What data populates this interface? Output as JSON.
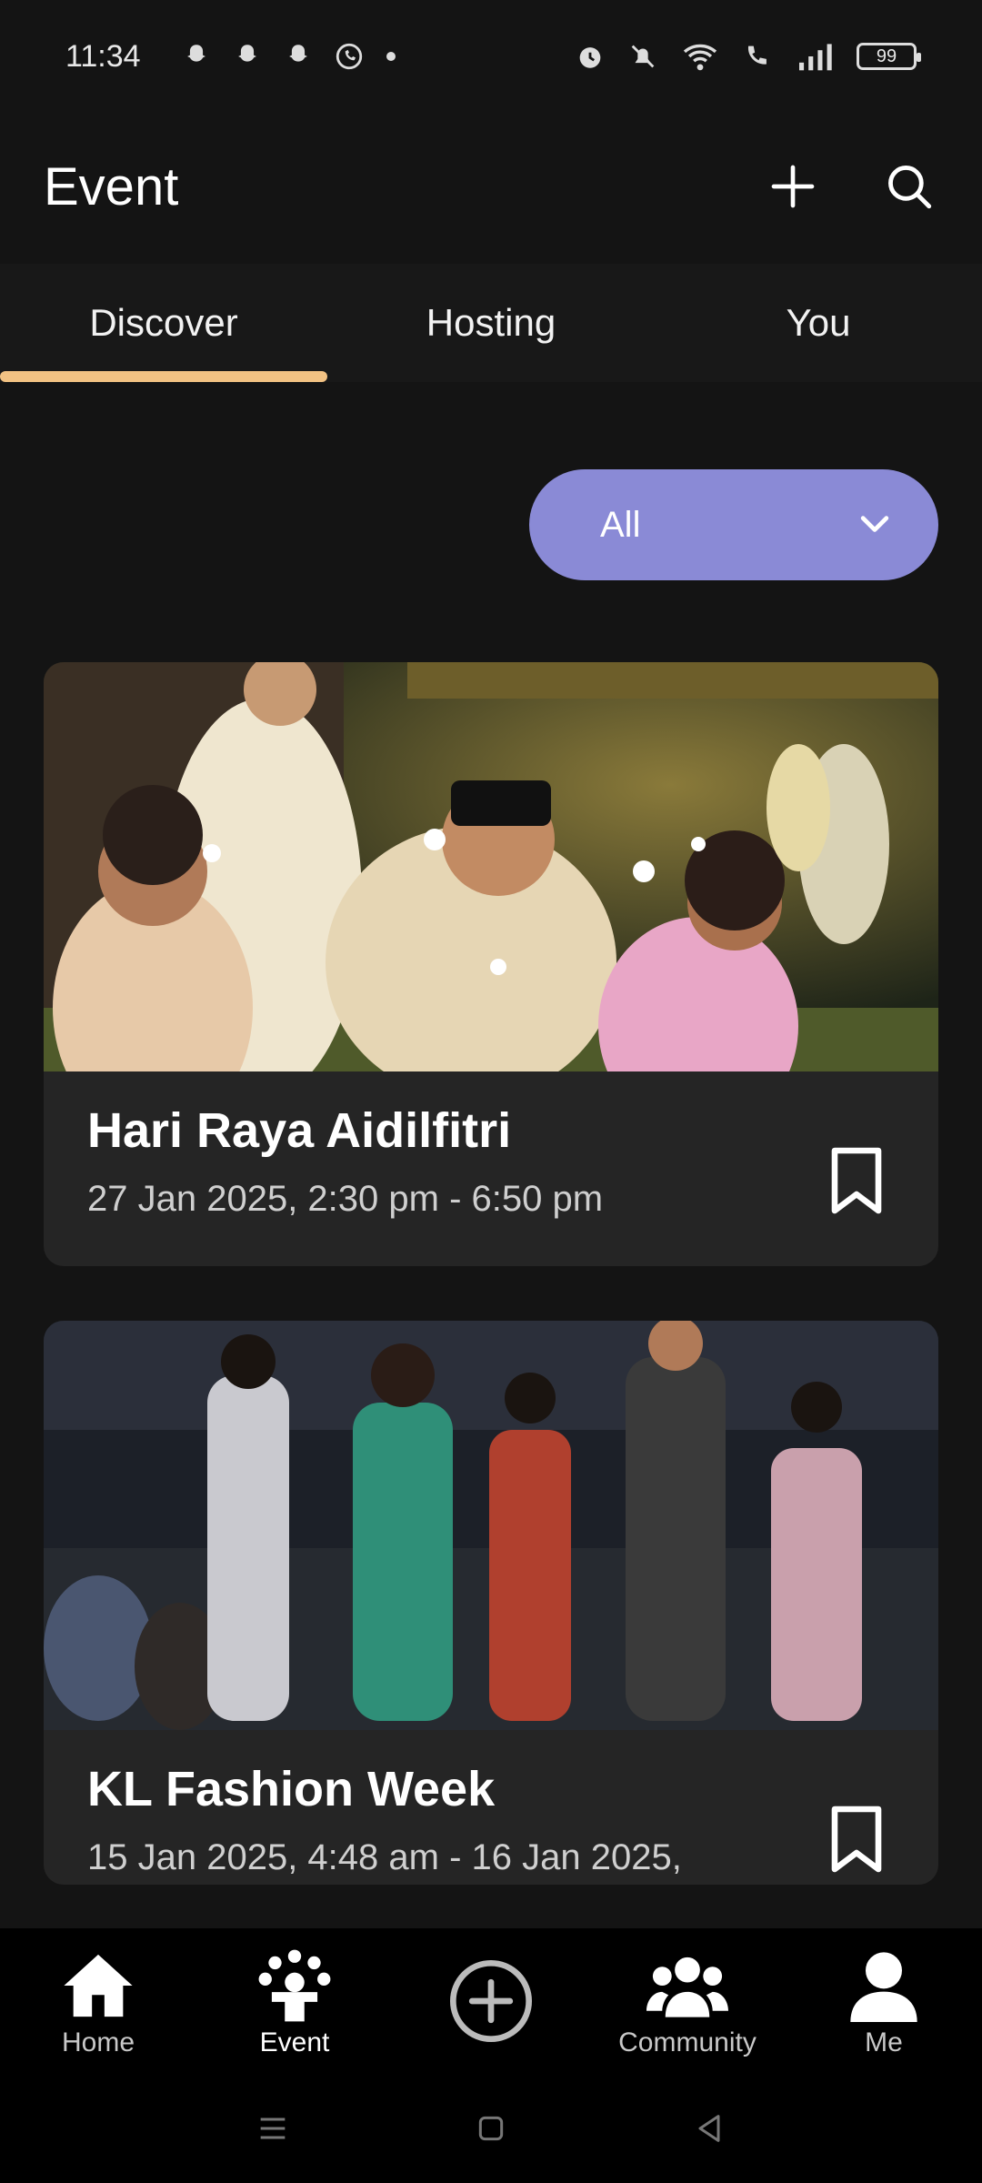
{
  "status_bar": {
    "time": "11:34",
    "battery": "99",
    "left_icons": [
      "snapchat-icon",
      "snapchat-icon",
      "snapchat-icon",
      "whatsapp-icon",
      "dot-icon"
    ],
    "right_icons": [
      "alarm-icon",
      "mute-icon",
      "wifi-icon",
      "call-icon",
      "signal-icon",
      "battery-icon"
    ]
  },
  "header": {
    "title": "Event",
    "actions": [
      "add-icon",
      "search-icon"
    ]
  },
  "tabs": [
    {
      "label": "Discover",
      "active": true
    },
    {
      "label": "Hosting",
      "active": false
    },
    {
      "label": "You",
      "active": false
    }
  ],
  "filter": {
    "selected": "All"
  },
  "events": [
    {
      "title": "Hari Raya Aidilfitri",
      "date": "27 Jan 2025, 2:30 pm - 6:50 pm"
    },
    {
      "title": "KL Fashion Week",
      "date": "15 Jan 2025, 4:48 am - 16 Jan 2025,"
    }
  ],
  "bottom_nav": [
    {
      "label": "Home",
      "icon": "home-icon"
    },
    {
      "label": "Event",
      "icon": "event-icon",
      "active": true
    },
    {
      "label": "",
      "icon": "add-circle-icon"
    },
    {
      "label": "Community",
      "icon": "community-icon"
    },
    {
      "label": "Me",
      "icon": "profile-icon"
    }
  ],
  "colors": {
    "background": "#141414",
    "accent_tab": "#f2c283",
    "filter": "#8a8ad6",
    "card": "#252525"
  }
}
